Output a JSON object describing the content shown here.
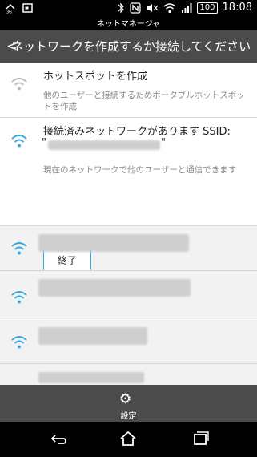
{
  "statusbar": {
    "signal_badge": "3G",
    "time": "18:08",
    "battery": "100"
  },
  "app": {
    "name": "ネットマネージャ",
    "header_title": "ネットワークを作成するか接続してください"
  },
  "items": {
    "hotspot": {
      "title": "ホットスポットを作成",
      "subtitle": "他のユーザーと接続するためポータブルホットスポットを作成"
    },
    "connected": {
      "title": "接続済みネットワークがあります SSID:",
      "ssid_quote": "\"",
      "subtitle": "現在のネットワークで他のユーザーと通信できます",
      "end_button": "終了"
    }
  },
  "bottom": {
    "settings_label": "設定"
  },
  "colors": {
    "accent": "#36a9e0",
    "header_bg": "#4b4b4b",
    "list_bg": "#f2f2f2"
  }
}
